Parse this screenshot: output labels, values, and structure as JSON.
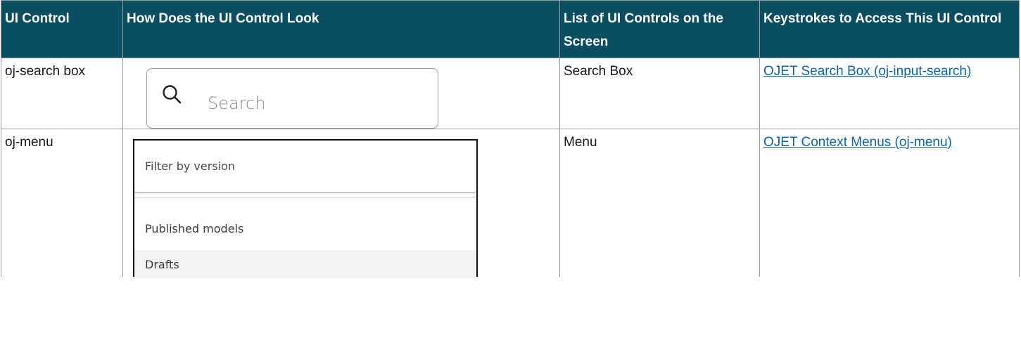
{
  "headers": [
    "UI Control",
    "How Does the UI Control Look",
    "List of UI Controls on the Screen",
    "Keystrokes to Access This UI Control"
  ],
  "rows": [
    {
      "control": "oj-search box",
      "preview": {
        "placeholder": "Search",
        "icon": "search-icon"
      },
      "list": "Search Box",
      "link": "OJET Search Box (oj-input-search)"
    },
    {
      "control": "oj-menu",
      "preview": {
        "filter_placeholder": "Filter by version",
        "items": [
          "Published models",
          "Drafts"
        ]
      },
      "list": "Menu",
      "link": "OJET Context Menus (oj-menu)"
    }
  ],
  "colors": {
    "header_bg": "#0b4d61",
    "link": "#0a66a8",
    "menu_highlight": "#f3f3f3"
  }
}
